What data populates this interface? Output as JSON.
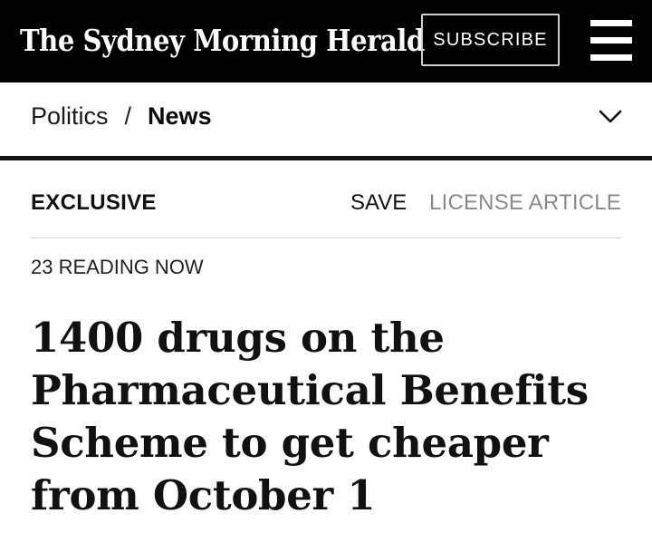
{
  "header": {
    "masthead": "The Sydney Morning Herald",
    "subscribe_label": "SUBSCRIBE",
    "menu_icon": "hamburger-menu-icon"
  },
  "breadcrumb": {
    "section": "Politics",
    "separator": "/",
    "current": "News",
    "expand_icon": "chevron-down-icon"
  },
  "article": {
    "tag": "EXCLUSIVE",
    "save_label": "SAVE",
    "license_label": "LICENSE ARTICLE",
    "reading_now": "23 READING NOW",
    "headline": "1400 drugs on the Pharmaceutical Benefits Scheme to get cheaper from October 1"
  },
  "colors": {
    "header_background": "#000000",
    "page_background": "#ffffff",
    "text": "#111111",
    "muted_text": "#8a8a8a"
  }
}
